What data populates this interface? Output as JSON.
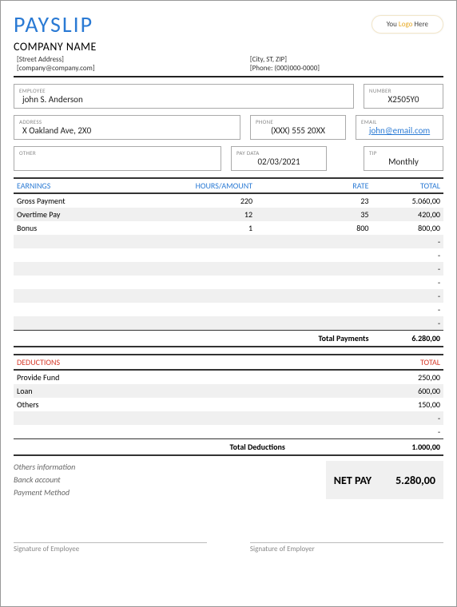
{
  "header": {
    "title": "PAYSLIP",
    "logo_pre": "You ",
    "logo_mid": "Logo",
    "logo_post": " Here",
    "company": "COMPANY NAME",
    "street": "[Street Address]",
    "email": "[company@company.com]",
    "city": "[City, ST, ZIP]",
    "phone": "[Phone: (000)000-0000]"
  },
  "fields": {
    "employee_label": "EMPLOYEE",
    "employee": "john S. Anderson",
    "number_label": "NUMBER",
    "number": "X2505Y0",
    "address_label": "ADDRESS",
    "address": "X Oakland Ave, 2X0",
    "phone_label": "PHONE",
    "phone": "(XXX) 555 20XX",
    "email_label": "EMAIL",
    "email": "john@email.com",
    "other_label": "OTHER",
    "other": "",
    "paydate_label": "PAY DATA",
    "paydate": "02/03/2021",
    "tip_label": "TIP",
    "tip": "Monthly"
  },
  "earnings": {
    "h1": "EARNINGS",
    "h2": "HOURS/AMOUNT",
    "h3": "RATE",
    "h4": "TOTAL",
    "rows": [
      {
        "desc": "Gross Payment",
        "hours": "220",
        "rate": "23",
        "total": "5.060,00"
      },
      {
        "desc": "Overtime Pay",
        "hours": "12",
        "rate": "35",
        "total": "420,00"
      },
      {
        "desc": "Bonus",
        "hours": "1",
        "rate": "800",
        "total": "800,00"
      },
      {
        "desc": "",
        "hours": "",
        "rate": "",
        "total": "-"
      },
      {
        "desc": "",
        "hours": "",
        "rate": "",
        "total": "-"
      },
      {
        "desc": "",
        "hours": "",
        "rate": "",
        "total": "-"
      },
      {
        "desc": "",
        "hours": "",
        "rate": "",
        "total": "-"
      },
      {
        "desc": "",
        "hours": "",
        "rate": "",
        "total": "-"
      },
      {
        "desc": "",
        "hours": "",
        "rate": "",
        "total": "-"
      },
      {
        "desc": "",
        "hours": "",
        "rate": "",
        "total": "-"
      }
    ],
    "total_label": "Total Payments",
    "total": "6.280,00"
  },
  "deductions": {
    "h1": "DEDUCTIONS",
    "h4": "TOTAL",
    "rows": [
      {
        "desc": "Provide Fund",
        "total": "250,00"
      },
      {
        "desc": "Loan",
        "total": "600,00"
      },
      {
        "desc": "Others",
        "total": "150,00"
      },
      {
        "desc": "",
        "total": "-"
      },
      {
        "desc": "",
        "total": "-"
      }
    ],
    "total_label": "Total Deductions",
    "total": "1.000,00"
  },
  "footer": {
    "others_info": "Others information",
    "bank": "Banck account",
    "method": "Payment Method",
    "netpay_label": "NET PAY",
    "netpay": "5.280,00",
    "sig_emp": "Signature of Employee",
    "sig_empr": "Signature of Employer"
  }
}
